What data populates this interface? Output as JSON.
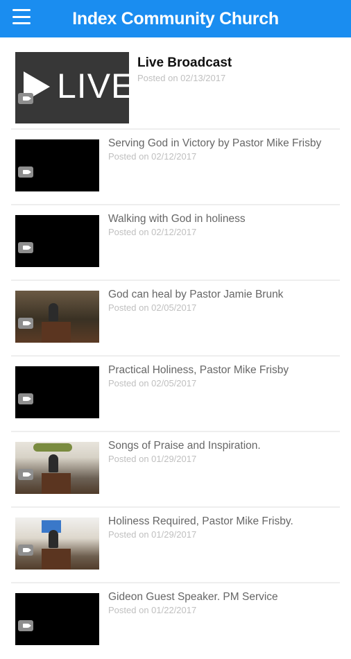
{
  "header": {
    "title": "Index Community Church",
    "menu_icon": "hamburger-menu-icon",
    "color": "#1a8df0"
  },
  "posts": [
    {
      "title": "Live Broadcast",
      "date": "Posted on 02/13/2017",
      "thumb_text": "LIVE"
    },
    {
      "title": "Serving God in Victory by Pastor Mike Frisby",
      "date": "Posted on 02/12/2017"
    },
    {
      "title": "Walking with God in holiness",
      "date": "Posted on 02/12/2017"
    },
    {
      "title": "God can heal by Pastor Jamie Brunk",
      "date": "Posted on 02/05/2017"
    },
    {
      "title": "Practical Holiness, Pastor Mike Frisby",
      "date": "Posted on 02/05/2017"
    },
    {
      "title": "Songs of Praise and Inspiration.",
      "date": "Posted on 01/29/2017"
    },
    {
      "title": "Holiness Required, Pastor Mike Frisby.",
      "date": "Posted on 01/29/2017"
    },
    {
      "title": "Gideon Guest Speaker. PM Service",
      "date": "Posted on 01/22/2017"
    }
  ]
}
